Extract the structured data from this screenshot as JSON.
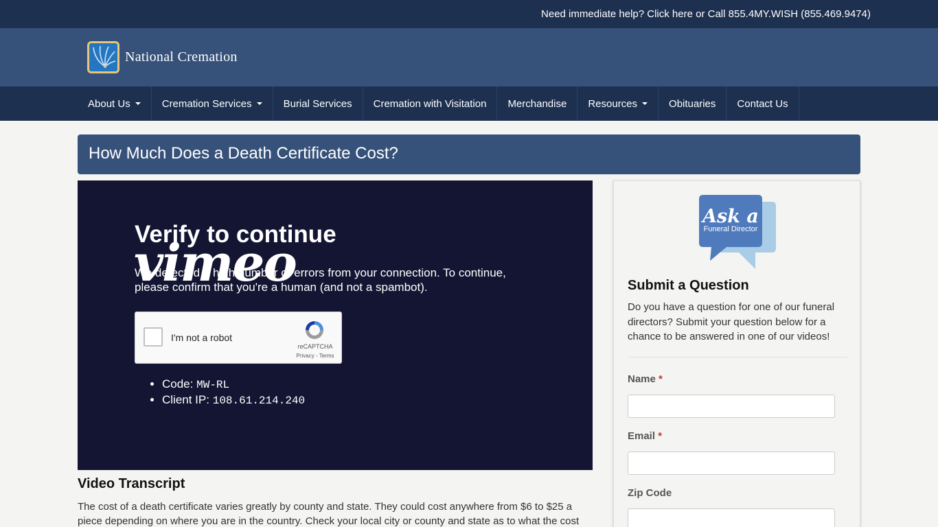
{
  "topbar": {
    "help_text": "Need immediate help? Click here or Call 855.4MY.WISH (855.469.9474)"
  },
  "header": {
    "logo_text": "National Cremation"
  },
  "nav": {
    "items": [
      {
        "label": "About Us",
        "dropdown": true
      },
      {
        "label": "Cremation Services",
        "dropdown": true
      },
      {
        "label": "Burial Services",
        "dropdown": false
      },
      {
        "label": "Cremation with Visitation",
        "dropdown": false
      },
      {
        "label": "Merchandise",
        "dropdown": false
      },
      {
        "label": "Resources",
        "dropdown": true
      },
      {
        "label": "Obituaries",
        "dropdown": false
      },
      {
        "label": "Contact Us",
        "dropdown": false
      }
    ]
  },
  "page": {
    "title": "How Much Does a Death Certificate Cost?"
  },
  "video": {
    "logo": "vimeo",
    "verify_title": "Verify to continue",
    "verify_text": "We detected a high number of errors from your connection. To continue, please confirm that you're a human (and not a spambot).",
    "captcha": {
      "label": "I'm not a robot",
      "brand": "reCAPTCHA",
      "links": "Privacy - Terms"
    },
    "code_label": "Code:",
    "code_value": "MW-RL",
    "ip_label": "Client IP:",
    "ip_value": "108.61.214.240"
  },
  "transcript": {
    "title": "Video Transcript",
    "text": "The cost of a death certificate varies greatly by county and state. They could cost anywhere from $6 to $25 a piece depending on where you are in the country. Check your local city or county and state as to what the cost"
  },
  "sidebar": {
    "logo_line1": "Ask a",
    "logo_line2": "Funeral Director",
    "title": "Submit a Question",
    "text": "Do you have a question for one of our funeral directors? Submit your question below for a chance to be answered in one of our videos!",
    "fields": {
      "name": "Name",
      "email": "Email",
      "zip": "Zip Code"
    },
    "required_mark": "*"
  },
  "colors": {
    "topbar": "#1d3050",
    "header": "#37527a",
    "video_bg": "#141533",
    "logo_border": "#e6c67a"
  }
}
